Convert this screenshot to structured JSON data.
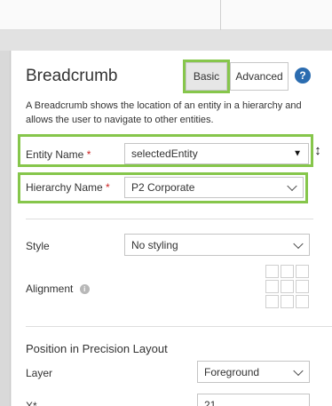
{
  "panel": {
    "title": "Breadcrumb",
    "description": "A Breadcrumb shows the location of an entity in a hierarchy and allows the user to navigate to other entities.",
    "mode_basic": "Basic",
    "mode_advanced": "Advanced",
    "help_glyph": "?"
  },
  "fields": {
    "entity_name": {
      "label": "Entity Name",
      "required_mark": "*",
      "value": "selectedEntity"
    },
    "hierarchy_name": {
      "label": "Hierarchy Name",
      "required_mark": "*",
      "value": "P2 Corporate"
    },
    "style": {
      "label": "Style",
      "value": "No styling"
    },
    "alignment": {
      "label": "Alignment",
      "info_glyph": "i"
    }
  },
  "position": {
    "section_title": "Position in Precision Layout",
    "layer": {
      "label": "Layer",
      "value": "Foreground"
    },
    "x": {
      "label": "X*",
      "value": "21"
    }
  },
  "colors": {
    "highlight": "#86c64b",
    "help_blue": "#2b6cb0",
    "required_red": "#cc2222"
  },
  "icons": {
    "help": "help-icon",
    "info": "info-icon",
    "dropdown": "chevron-down-icon",
    "resize": "resize-vertical-icon"
  }
}
